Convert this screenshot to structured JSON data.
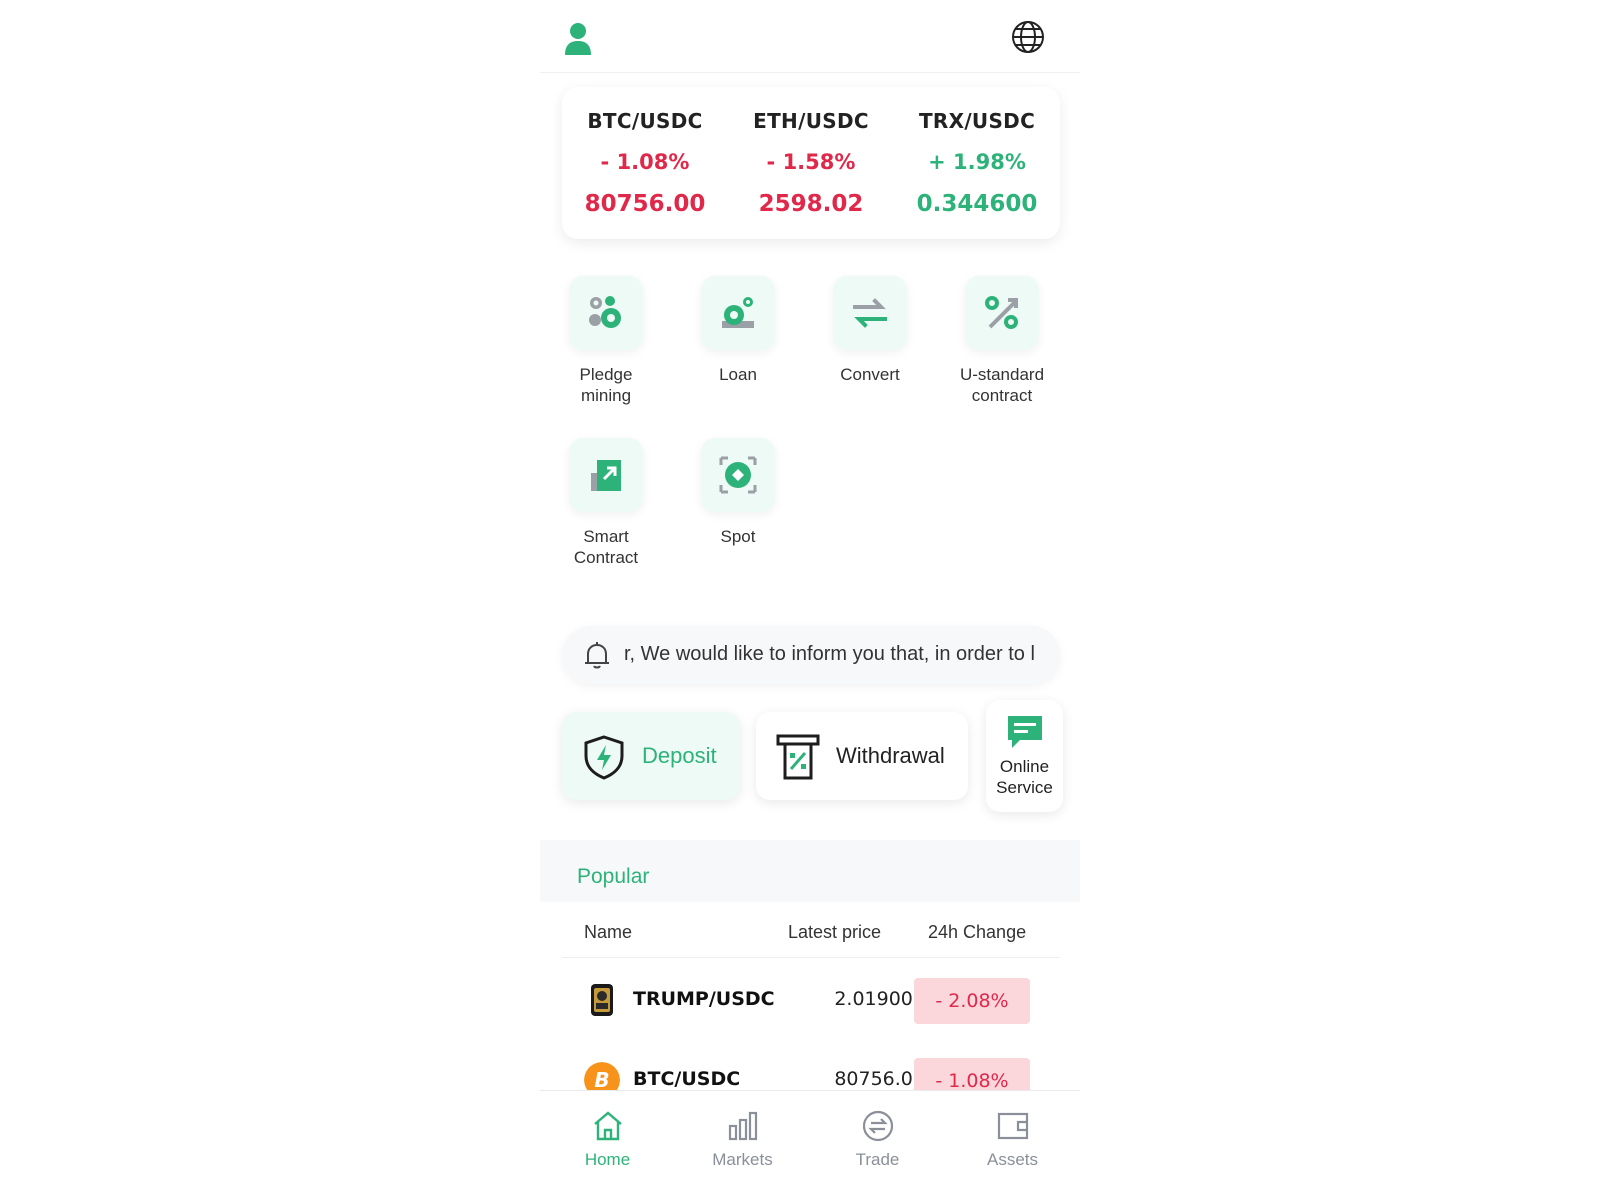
{
  "header": {
    "user_icon": "user-icon",
    "language_icon": "globe-icon"
  },
  "ticker": [
    {
      "pair": "BTC/USDC",
      "change": "- 1.08%",
      "price": "80756.00",
      "trend": "down"
    },
    {
      "pair": "ETH/USDC",
      "change": "- 1.58%",
      "price": "2598.02",
      "trend": "down"
    },
    {
      "pair": "TRX/USDC",
      "change": "+ 1.98%",
      "price": "0.344600",
      "trend": "up"
    }
  ],
  "features": [
    {
      "label": "Pledge mining",
      "icon": "pledge-mining-icon"
    },
    {
      "label": "Loan",
      "icon": "loan-icon"
    },
    {
      "label": "Convert",
      "icon": "convert-icon"
    },
    {
      "label": "U-standard contract",
      "icon": "percent-icon"
    },
    {
      "label": "Smart Contract",
      "icon": "smart-contract-icon"
    },
    {
      "label": "Spot",
      "icon": "spot-icon"
    }
  ],
  "notice": {
    "text": "r, We would like to inform you that, in order to l",
    "icon": "bell-icon"
  },
  "actions": {
    "deposit": "Deposit",
    "withdrawal": "Withdrawal",
    "online_service_line1": "Online",
    "online_service_line2": "Service"
  },
  "popular": {
    "title": "Popular",
    "columns": {
      "name": "Name",
      "price": "Latest price",
      "change": "24h Change"
    },
    "rows": [
      {
        "name": "TRUMP/USDC",
        "price": "2.019000",
        "change": "- 2.08%",
        "icon": "trump-coin-icon"
      },
      {
        "name": "BTC/USDC",
        "price": "80756.00",
        "change": "- 1.08%",
        "icon": "bitcoin-icon"
      }
    ]
  },
  "nav": [
    {
      "label": "Home",
      "icon": "home-icon",
      "active": true
    },
    {
      "label": "Markets",
      "icon": "bar-chart-icon",
      "active": false
    },
    {
      "label": "Trade",
      "icon": "trade-icon",
      "active": false
    },
    {
      "label": "Assets",
      "icon": "wallet-icon",
      "active": false
    }
  ],
  "colors": {
    "accent": "#2db37a",
    "down": "#e0284a",
    "up": "#2db37a",
    "down_badge_bg": "#fbd7dc"
  }
}
